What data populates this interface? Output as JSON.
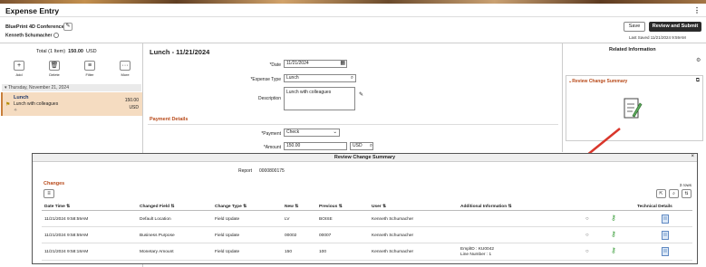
{
  "header": {
    "title": "Expense Entry",
    "menu_icon": "kebab-icon"
  },
  "report": {
    "name": "BluePrint 4D Conference",
    "employee": "Kenneth Schumacher"
  },
  "actions": {
    "save": "Save",
    "review_submit": "Review and Submit",
    "last_saved": "Last Saved   11/21/2024  9:59AM"
  },
  "summary": {
    "total_prefix": "Total (1 Item)",
    "total_amount": "150.00",
    "currency": "USD"
  },
  "toolbar": {
    "add": "Add",
    "delete": "Delete",
    "filter": "Filter",
    "more": "More"
  },
  "expense_list": {
    "date_header": "Thursday, November 21, 2024",
    "item": {
      "name": "Lunch",
      "description": "Lunch with colleagues",
      "amount": "150.00",
      "currency": "USD"
    }
  },
  "detail": {
    "title": "Lunch - 11/21/2024",
    "date_label": "*Date",
    "date_value": "11/21/2024",
    "type_label": "*Expense Type",
    "type_value": "Lunch",
    "description_label": "Description",
    "description_value": "Lunch with colleagues",
    "payment_section": "Payment Details",
    "payment_label": "*Payment",
    "payment_value": "Check",
    "amount_label": "*Amount",
    "amount_value": "150.00",
    "amount_currency": "USD"
  },
  "related": {
    "title": "Related Information",
    "panel_title": "Review Change Summary"
  },
  "modal": {
    "title": "Review Change Summary",
    "report_label": "Report",
    "report_value": "0000800175",
    "changes_label": "Changes",
    "rows_count": "3 rows",
    "columns": [
      "Date Time",
      "Changed Field",
      "Change Type",
      "New",
      "Previous",
      "User",
      "Additional Information",
      "Technical Details"
    ],
    "rows": [
      {
        "datetime": "11/21/2024  9:58:59AM",
        "field": "Default Location",
        "type": "Field Update",
        "new": "LV",
        "previous": "BOISE",
        "user": "Kenneth Schumacher",
        "info_line1": "",
        "info_line2": ""
      },
      {
        "datetime": "11/21/2024  9:58:59AM",
        "field": "Business Purpose",
        "type": "Field Update",
        "new": "00002",
        "previous": "00007",
        "user": "Kenneth Schumacher",
        "info_line1": "",
        "info_line2": ""
      },
      {
        "datetime": "11/21/2024  9:58:18AM",
        "field": "Monetary Amount",
        "type": "Field Update",
        "new": "150",
        "previous": "100",
        "user": "Kenneth Schumacher",
        "info_line1": "EmplID : KU0042",
        "info_line2": "Line Number : 1"
      }
    ]
  },
  "colors": {
    "accent": "#b84a1a",
    "selected_row": "#f5dcc1",
    "primary_button": "#2b2b2b",
    "arrow": "#d9362b"
  }
}
